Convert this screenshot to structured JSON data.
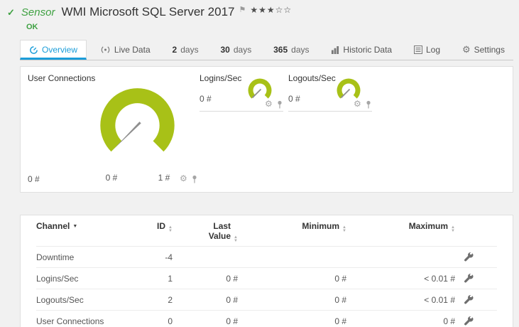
{
  "colors": {
    "accent": "#1b9dd9",
    "gauge": "#a8c117",
    "green": "#3fa142"
  },
  "icons": {
    "check": "✓",
    "flag": "⚑",
    "gear": "⚙",
    "sort_up": "▲",
    "sort_down": "▼",
    "sort_active": "▼"
  },
  "header": {
    "kind": "Sensor",
    "title": "WMI Microsoft SQL Server 2017",
    "stars_filled": "★★★",
    "stars_empty": "☆☆",
    "status": "OK"
  },
  "tabs": [
    {
      "label": "Overview"
    },
    {
      "label": "Live Data"
    },
    {
      "num": "2",
      "unit": "days"
    },
    {
      "num": "30",
      "unit": "days"
    },
    {
      "num": "365",
      "unit": "days"
    },
    {
      "label": "Historic Data"
    },
    {
      "label": "Log"
    },
    {
      "label": "Settings"
    }
  ],
  "gauges": {
    "main": {
      "title": "User Connections",
      "current": "0 #",
      "min": "0 #",
      "max": "1 #"
    },
    "logins": {
      "title": "Logins/Sec",
      "value": "0 #"
    },
    "logouts": {
      "title": "Logouts/Sec",
      "value": "0 #"
    }
  },
  "table": {
    "headers": {
      "channel": "Channel",
      "id": "ID",
      "last": "Last Value",
      "min": "Minimum",
      "max": "Maximum"
    },
    "rows": [
      {
        "channel": "Downtime",
        "id": "-4",
        "last": "",
        "min": "",
        "max": ""
      },
      {
        "channel": "Logins/Sec",
        "id": "1",
        "last": "0 #",
        "min": "0 #",
        "max": "< 0.01 #"
      },
      {
        "channel": "Logouts/Sec",
        "id": "2",
        "last": "0 #",
        "min": "0 #",
        "max": "< 0.01 #"
      },
      {
        "channel": "User Connections",
        "id": "0",
        "last": "0 #",
        "min": "0 #",
        "max": "0 #"
      }
    ]
  }
}
